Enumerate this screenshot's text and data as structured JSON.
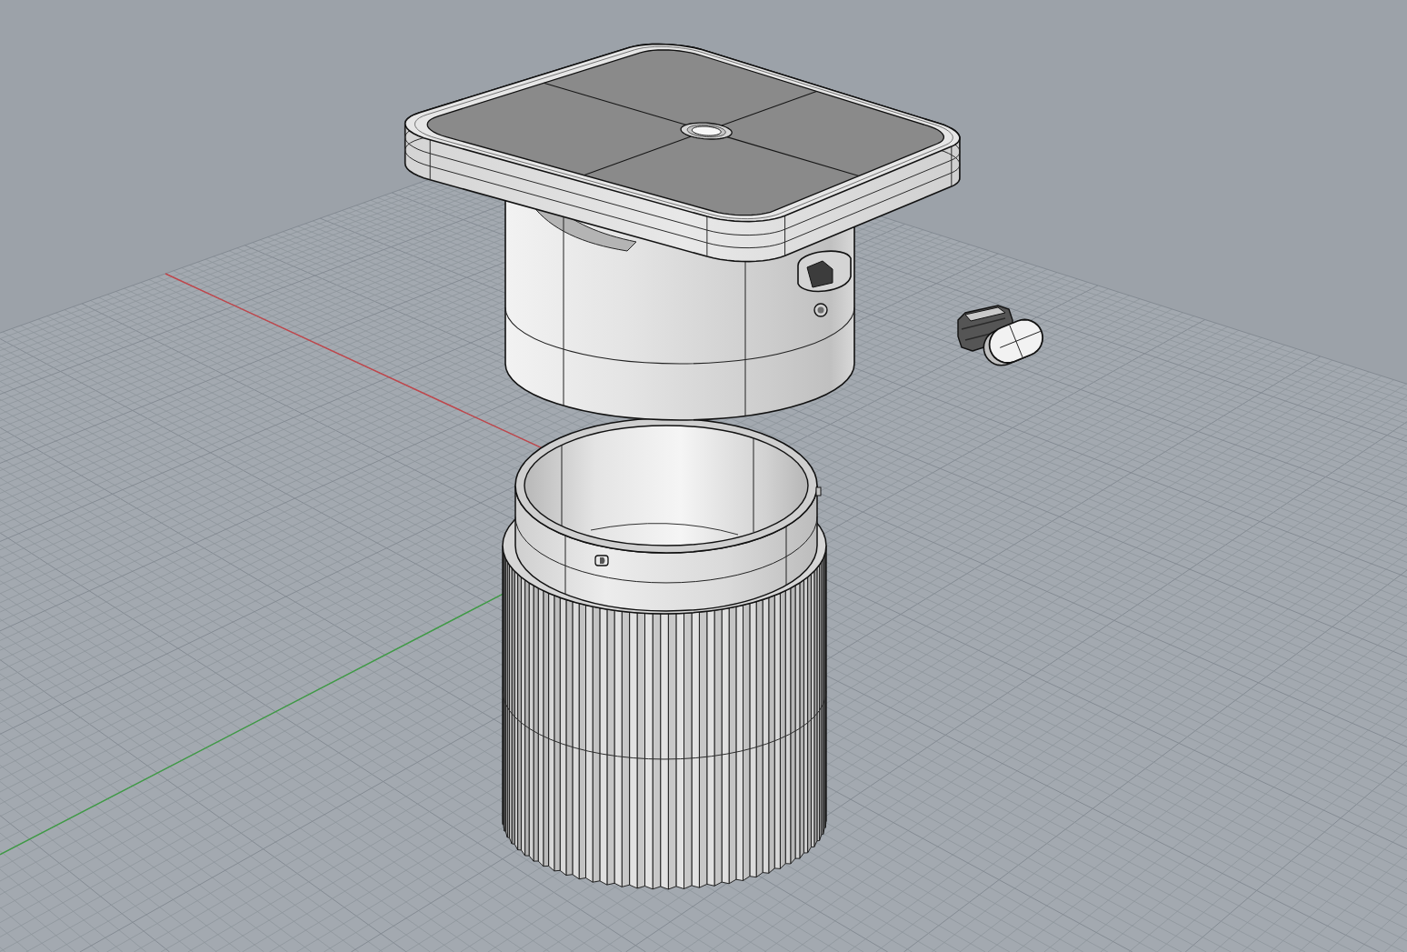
{
  "viewport": {
    "axes": [
      {
        "kind": "x",
        "color": "#c0464b"
      },
      {
        "kind": "y",
        "color": "#3f9b45"
      }
    ],
    "objects": [
      {
        "kind": "plate"
      },
      {
        "kind": "housing"
      },
      {
        "kind": "clip"
      },
      {
        "kind": "canister"
      }
    ]
  }
}
